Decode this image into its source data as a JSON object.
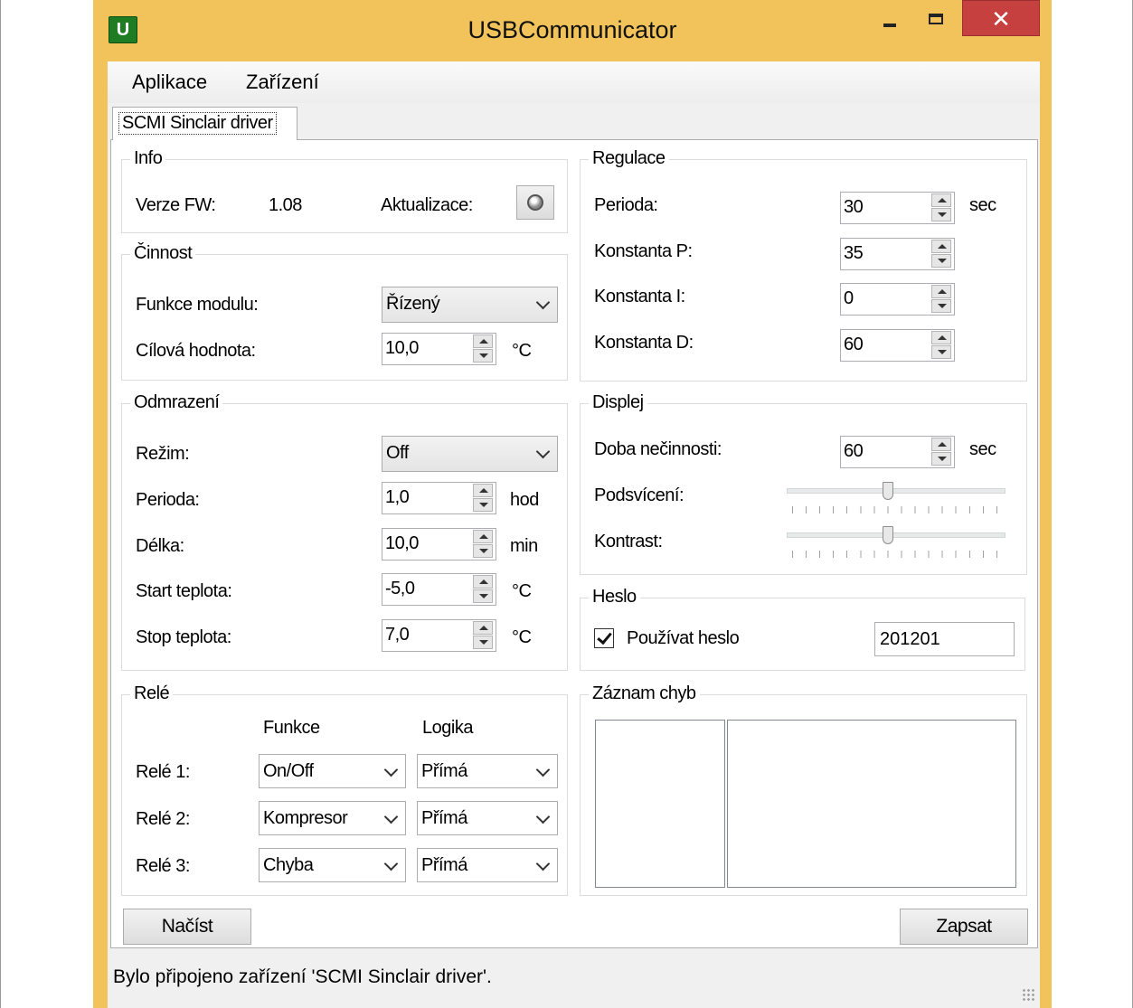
{
  "window": {
    "title": "USBCommunicator",
    "icon_letter": "U",
    "close_glyph": "✕"
  },
  "menu": {
    "items": [
      "Aplikace",
      "Zařízení"
    ]
  },
  "tab": {
    "label": "SCMI Sinclair driver"
  },
  "info": {
    "legend": "Info",
    "fw_label": "Verze FW:",
    "fw_value": "1.08",
    "update_label": "Aktualizace:"
  },
  "cinnost": {
    "legend": "Činnost",
    "function_label": "Funkce modulu:",
    "function_value": "Řízený",
    "target_label": "Cílová hodnota:",
    "target_value": "10,0",
    "target_unit": "°C"
  },
  "odmrazeni": {
    "legend": "Odmrazení",
    "mode_label": "Režim:",
    "mode_value": "Off",
    "rows": [
      {
        "label": "Perioda:",
        "value": "1,0",
        "unit": "hod"
      },
      {
        "label": "Délka:",
        "value": "10,0",
        "unit": "min"
      },
      {
        "label": "Start teplota:",
        "value": "-5,0",
        "unit": "°C"
      },
      {
        "label": "Stop teplota:",
        "value": "7,0",
        "unit": "°C"
      }
    ]
  },
  "rele": {
    "legend": "Relé",
    "col_function": "Funkce",
    "col_logic": "Logika",
    "rows": [
      {
        "label": "Relé 1:",
        "function": "On/Off",
        "logic": "Přímá"
      },
      {
        "label": "Relé 2:",
        "function": "Kompresor",
        "logic": "Přímá"
      },
      {
        "label": "Relé 3:",
        "function": "Chyba",
        "logic": "Přímá"
      }
    ]
  },
  "regulace": {
    "legend": "Regulace",
    "rows": [
      {
        "label": "Perioda:",
        "value": "30",
        "unit": "sec"
      },
      {
        "label": "Konstanta P:",
        "value": "35",
        "unit": ""
      },
      {
        "label": "Konstanta I:",
        "value": "0",
        "unit": ""
      },
      {
        "label": "Konstanta D:",
        "value": "60",
        "unit": ""
      }
    ]
  },
  "displej": {
    "legend": "Displej",
    "idle_label": "Doba nečinnosti:",
    "idle_value": "60",
    "idle_unit": "sec",
    "backlight_label": "Podsvícení:",
    "backlight_level": 0.46,
    "contrast_label": "Kontrast:",
    "contrast_level": 0.46
  },
  "heslo": {
    "legend": "Heslo",
    "use_password_label": "Používat heslo",
    "use_password_checked": true,
    "password_value": "201201"
  },
  "errors": {
    "legend": "Záznam chyb"
  },
  "buttons": {
    "load": "Načíst",
    "write": "Zapsat"
  },
  "status": {
    "text": "Bylo připojeno zařízení 'SCMI Sinclair driver'."
  }
}
